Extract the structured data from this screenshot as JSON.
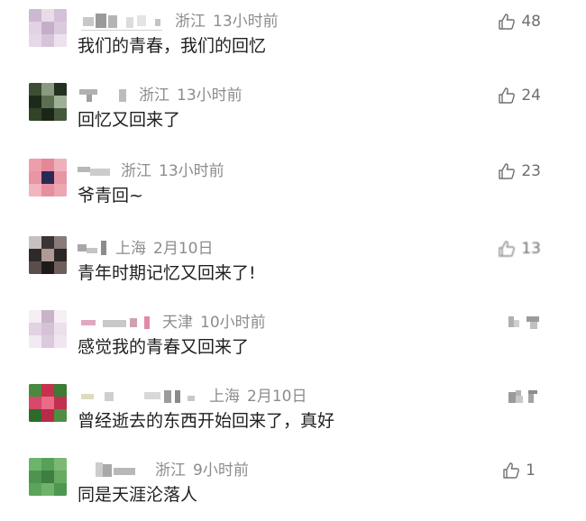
{
  "comments": [
    {
      "location": "浙江",
      "time": "13小时前",
      "text": "我们的青春，我们的回忆",
      "likes": "48",
      "avatar_color": "#d8c8dc"
    },
    {
      "location": "浙江",
      "time": "13小时前",
      "text": "回忆又回来了",
      "likes": "24",
      "avatar_color": "#2f3d2a"
    },
    {
      "location": "浙江",
      "time": "13小时前",
      "text": "爷青回~",
      "likes": "23",
      "avatar_color": "#e8a0aa"
    },
    {
      "location": "上海",
      "time": "2月10日",
      "text": "青年时期记忆又回来了!",
      "likes": "13",
      "avatar_color": "#4a4444"
    },
    {
      "location": "天津",
      "time": "10小时前",
      "text": "感觉我的青春又回来了",
      "likes": "",
      "avatar_color": "#e6dbe6"
    },
    {
      "location": "上海",
      "time": "2月10日",
      "text": "曾经逝去的东西开始回来了，真好",
      "likes": "",
      "avatar_color": "#d43a5a"
    },
    {
      "location": "浙江",
      "time": "9小时前",
      "text": "同是天涯沦落人",
      "likes": "1",
      "avatar_color": "#5fa860"
    }
  ]
}
